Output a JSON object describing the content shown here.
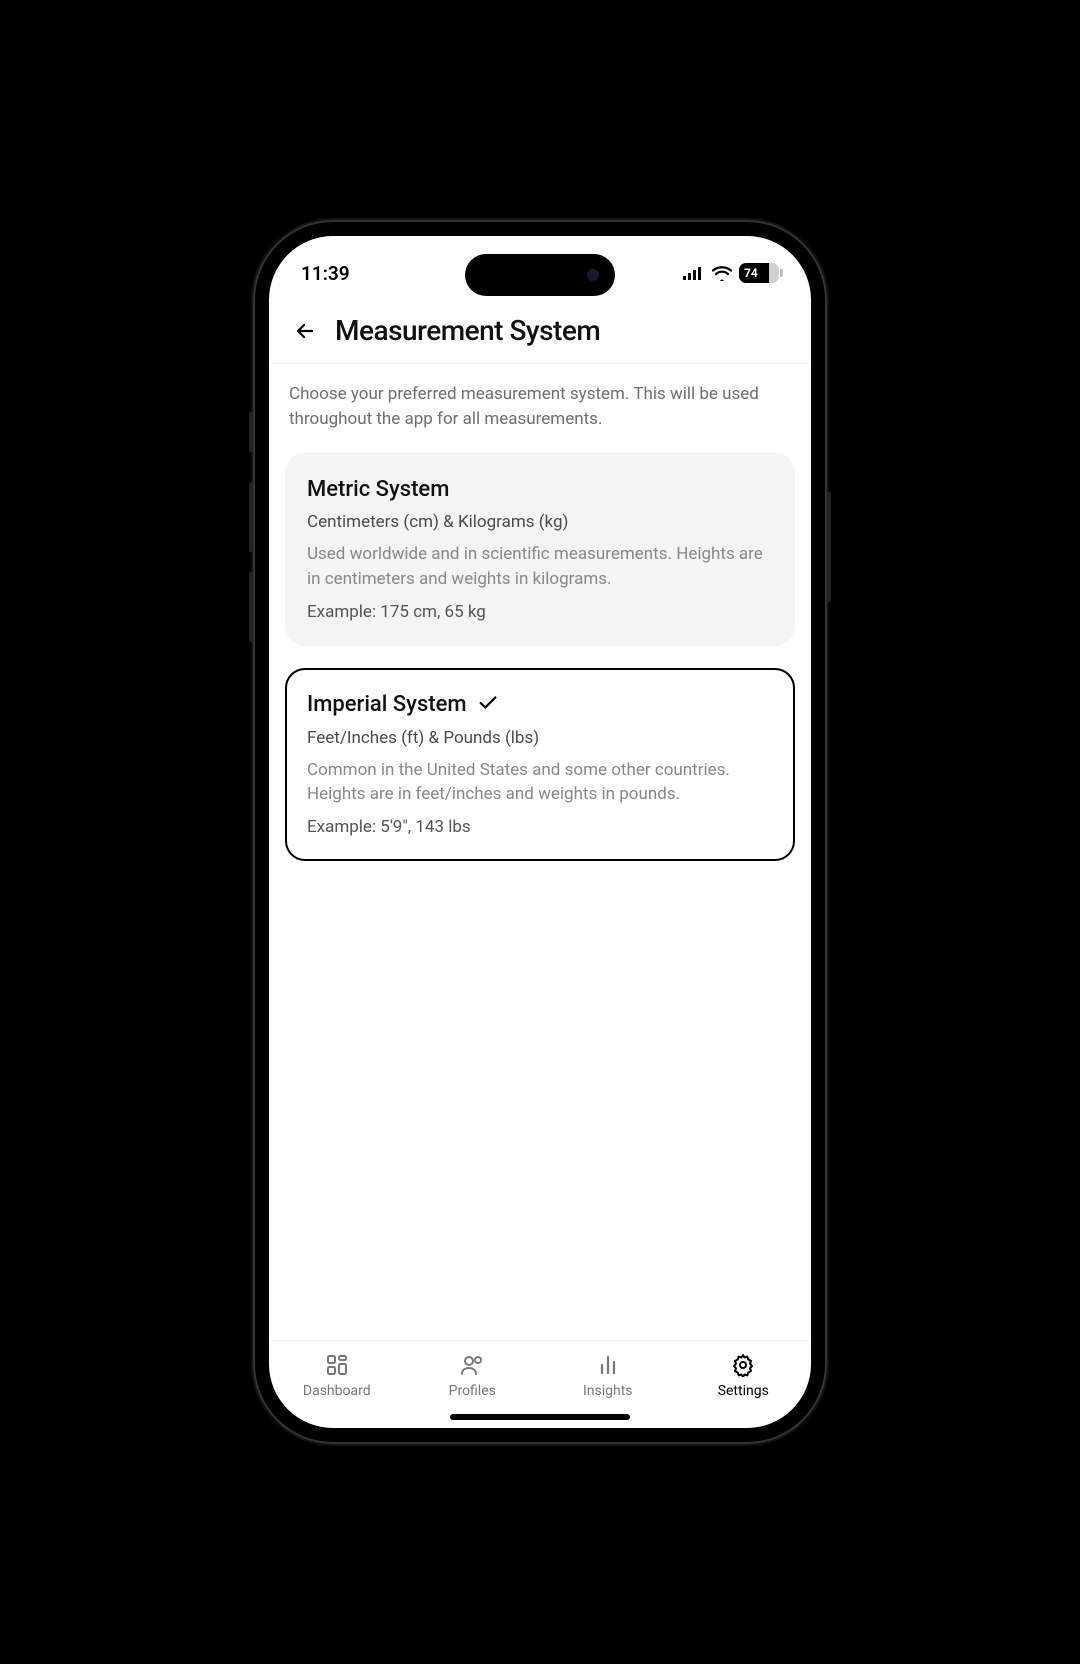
{
  "status": {
    "time": "11:39",
    "battery_pct": "74"
  },
  "header": {
    "title": "Measurement System"
  },
  "description": "Choose your preferred measurement system. This will be used throughout the app for all measurements.",
  "options": [
    {
      "title": "Metric System",
      "subtitle": "Centimeters (cm) & Kilograms (kg)",
      "detail": "Used worldwide and in scientific measurements. Heights are in centimeters and weights in kilograms.",
      "example": "Example: 175 cm, 65 kg",
      "selected": false
    },
    {
      "title": "Imperial System",
      "subtitle": "Feet/Inches (ft) & Pounds (lbs)",
      "detail": "Common in the United States and some other countries. Heights are in feet/inches and weights in pounds.",
      "example": "Example: 5'9\", 143 lbs",
      "selected": true
    }
  ],
  "tabs": [
    {
      "label": "Dashboard",
      "active": false
    },
    {
      "label": "Profiles",
      "active": false
    },
    {
      "label": "Insights",
      "active": false
    },
    {
      "label": "Settings",
      "active": true
    }
  ]
}
